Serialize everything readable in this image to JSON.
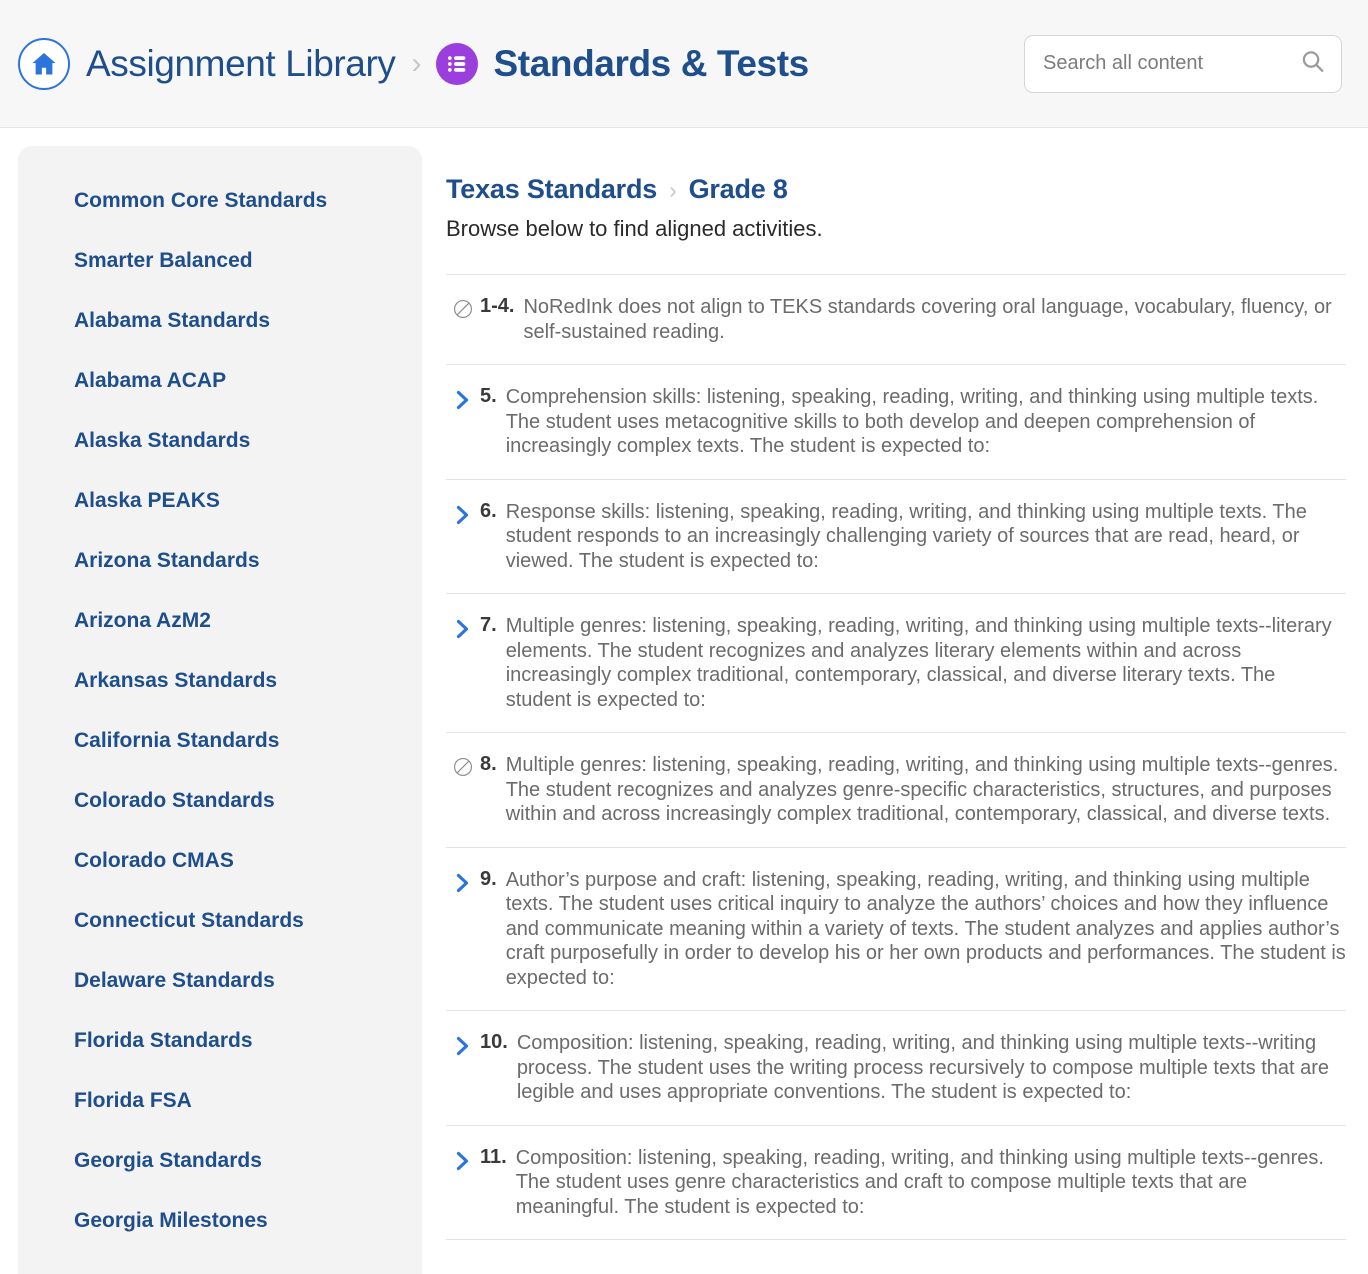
{
  "header": {
    "breadcrumb": [
      {
        "label": "Assignment Library",
        "icon": "home-icon"
      },
      {
        "label": "Standards & Tests",
        "icon": "list-icon"
      }
    ],
    "separator": "›",
    "search": {
      "placeholder": "Search all content",
      "value": "",
      "icon": "search-icon"
    },
    "colors": {
      "home_blue": "#2c74dd",
      "crumb_navy": "#1f4e8c",
      "list_purple": "#9a3ede"
    }
  },
  "sidebar": {
    "items": [
      {
        "label": "Common Core Standards"
      },
      {
        "label": "Smarter Balanced"
      },
      {
        "label": "Alabama Standards"
      },
      {
        "label": "Alabama ACAP"
      },
      {
        "label": "Alaska Standards"
      },
      {
        "label": "Alaska PEAKS"
      },
      {
        "label": "Arizona Standards"
      },
      {
        "label": "Arizona AzM2"
      },
      {
        "label": "Arkansas Standards"
      },
      {
        "label": "California Standards"
      },
      {
        "label": "Colorado Standards"
      },
      {
        "label": "Colorado CMAS"
      },
      {
        "label": "Connecticut Standards"
      },
      {
        "label": "Delaware Standards"
      },
      {
        "label": "Florida Standards"
      },
      {
        "label": "Florida FSA"
      },
      {
        "label": "Georgia Standards"
      },
      {
        "label": "Georgia Milestones"
      }
    ]
  },
  "main": {
    "title_primary": "Texas Standards",
    "title_separator": "›",
    "title_secondary": "Grade 8",
    "subtitle": "Browse below to find aligned activities.",
    "standards": [
      {
        "icon": "not-aligned-icon",
        "number": "1-4.",
        "text": "NoRedInk does not align to TEKS standards covering oral language, vocabulary, fluency, or self-sustained reading."
      },
      {
        "icon": "chevron-right-icon",
        "number": "5.",
        "text": "Comprehension skills: listening, speaking, reading, writing, and thinking using multiple texts. The student uses metacognitive skills to both develop and deepen comprehension of increasingly complex texts. The student is expected to:"
      },
      {
        "icon": "chevron-right-icon",
        "number": "6.",
        "text": "Response skills: listening, speaking, reading, writing, and thinking using multiple texts. The student responds to an increasingly challenging variety of sources that are read, heard, or viewed. The student is expected to:"
      },
      {
        "icon": "chevron-right-icon",
        "number": "7.",
        "text": "Multiple genres: listening, speaking, reading, writing, and thinking using multiple texts--literary elements. The student recognizes and analyzes literary elements within and across increasingly complex traditional, contemporary, classical, and diverse literary texts. The student is expected to:"
      },
      {
        "icon": "not-aligned-icon",
        "number": "8.",
        "text": "Multiple genres: listening, speaking, reading, writing, and thinking using multiple texts--genres. The student recognizes and analyzes genre-specific characteristics, structures, and purposes within and across increasingly complex traditional, contemporary, classical, and diverse texts."
      },
      {
        "icon": "chevron-right-icon",
        "number": "9.",
        "text": "Author’s purpose and craft: listening, speaking, reading, writing, and thinking using multiple texts. The student uses critical inquiry to analyze the authors’ choices and how they influence and communicate meaning within a variety of texts. The student analyzes and applies author’s craft purposefully in order to develop his or her own products and performances. The student is expected to:"
      },
      {
        "icon": "chevron-right-icon",
        "number": "10.",
        "text": "Composition: listening, speaking, reading, writing, and thinking using multiple texts--writing process. The student uses the writing process recursively to compose multiple texts that are legible and uses appropriate conventions. The student is expected to:"
      },
      {
        "icon": "chevron-right-icon",
        "number": "11.",
        "text": "Composition: listening, speaking, reading, writing, and thinking using multiple texts--genres. The student uses genre characteristics and craft to compose multiple texts that are meaningful. The student is expected to:"
      }
    ]
  }
}
